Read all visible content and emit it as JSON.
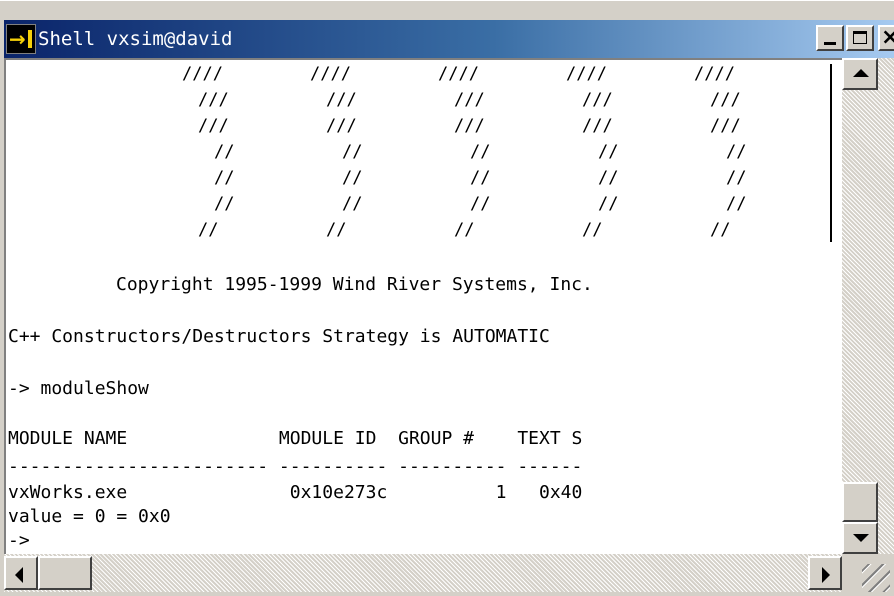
{
  "window": {
    "title": "Shell vxsim@david"
  },
  "terminal": {
    "art_rows": [
      "////",
      "///",
      "///",
      "//",
      "//",
      "//",
      "//"
    ],
    "copyright": "Copyright 1995-1999 Wind River Systems, Inc.",
    "strategy": "C++ Constructors/Destructors Strategy is AUTOMATIC",
    "command": "-> moduleShow",
    "header": "MODULE NAME              MODULE ID  GROUP #    TEXT S",
    "separator": "------------------------ ---------- ---------- ------",
    "row": "vxWorks.exe               0x10e273c          1   0x40",
    "value": "value = 0 = 0x0",
    "prompt": "->"
  },
  "icons": {
    "app": "shell-app-icon",
    "minimize": "minimize-icon",
    "maximize": "maximize-icon",
    "close": "close-icon"
  },
  "colors": {
    "titlebar_start": "#0a246a",
    "titlebar_end": "#a6caf0",
    "terminal_bg": "#ffffff"
  }
}
